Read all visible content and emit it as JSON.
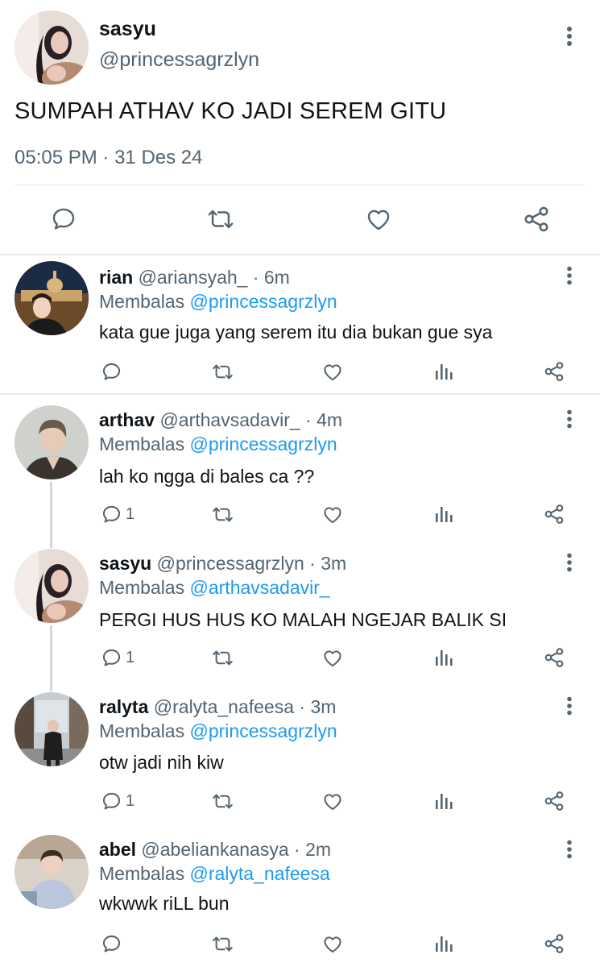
{
  "main_tweet": {
    "name": "sasyu",
    "handle": "@princessagrzlyn",
    "text": "SUMPAH ATHAV KO JADI SEREM GITU",
    "time": "05:05 PM",
    "separator": "·",
    "date": "31 Des 24",
    "actions": [
      "reply-icon",
      "retweet-icon",
      "like-icon",
      "share-icon"
    ]
  },
  "replies": [
    {
      "name": "rian",
      "handle": "@ariansyah_",
      "time": "· 6m",
      "reply_prefix": "Membalas",
      "reply_to": "@princessagrzlyn",
      "text": "kata gue juga yang serem itu dia bukan gue sya",
      "reply_count": ""
    },
    {
      "name": "arthav",
      "handle": "@arthavsadavir_",
      "time": "· 4m",
      "reply_prefix": "Membalas",
      "reply_to": "@princessagrzlyn",
      "text": "lah ko ngga di bales ca ??",
      "reply_count": "1"
    },
    {
      "name": "sasyu",
      "handle": "@princessagrzlyn",
      "time": "· 3m",
      "reply_prefix": "Membalas",
      "reply_to": "@arthavsadavir_",
      "text": "PERGI HUS HUS KO MALAH NGEJAR BALIK SI",
      "reply_count": "1"
    },
    {
      "name": "ralyta",
      "handle": "@ralyta_nafeesa",
      "time": "· 3m",
      "reply_prefix": "Membalas",
      "reply_to": "@princessagrzlyn",
      "text": "otw jadi nih kiw",
      "reply_count": "1"
    },
    {
      "name": "abel",
      "handle": "@abeliankanasya",
      "time": "· 2m",
      "reply_prefix": "Membalas",
      "reply_to": "@ralyta_nafeesa",
      "text": "wkwwk riLL bun",
      "reply_count": ""
    }
  ],
  "colors": {
    "text": "#0f1419",
    "secondary": "#536471",
    "mention": "#1d9bf0",
    "divider": "#e6eaee",
    "thread_line": "#cfd9de"
  }
}
